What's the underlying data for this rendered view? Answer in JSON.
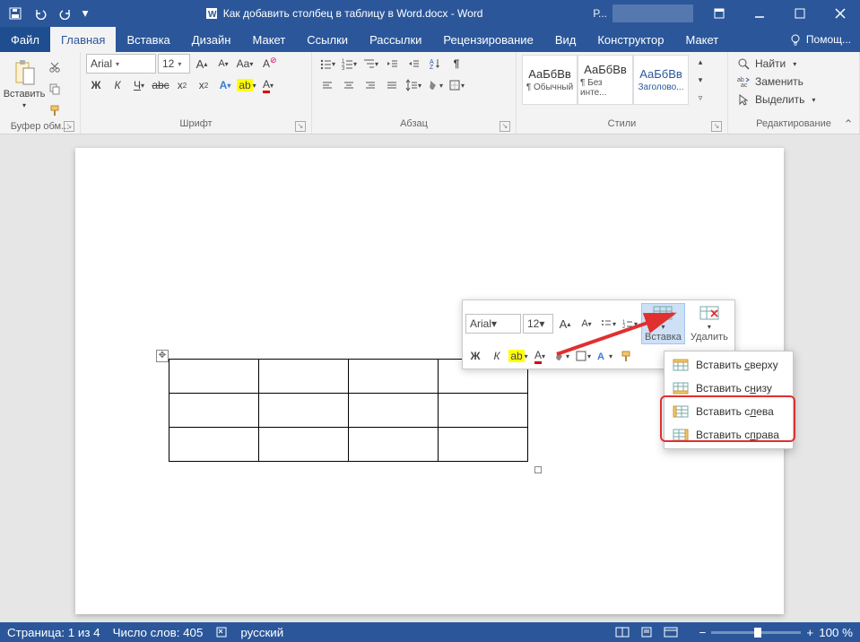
{
  "title": {
    "doc": "Как добавить столбец в таблицу в Word.docx",
    "app": "Word",
    "sep": " - ",
    "account_prefix": "Р..."
  },
  "tabs": {
    "file": "Файл",
    "home": "Главная",
    "insert": "Вставка",
    "design": "Дизайн",
    "layout": "Макет",
    "references": "Ссылки",
    "mailings": "Рассылки",
    "review": "Рецензирование",
    "view": "Вид",
    "tdesign": "Конструктор",
    "tlayout": "Макет",
    "tellme": "Помощ..."
  },
  "ribbon": {
    "clipboard": {
      "label": "Буфер обм...",
      "paste": "Вставить"
    },
    "font": {
      "label": "Шрифт",
      "name": "Arial",
      "size": "12"
    },
    "paragraph": {
      "label": "Абзац"
    },
    "styles": {
      "label": "Стили",
      "preview": "АаБбВв",
      "s1": "¶ Обычный",
      "s2": "¶ Без инте...",
      "s3": "Заголово..."
    },
    "editing": {
      "label": "Редактирование",
      "find": "Найти",
      "replace": "Заменить",
      "select": "Выделить"
    }
  },
  "mini": {
    "font": "Arial",
    "size": "12",
    "insert": "Вставка",
    "delete": "Удалить"
  },
  "menu": {
    "above": {
      "pre": "Вставить ",
      "hot": "с",
      "post": "верху"
    },
    "below": {
      "pre": "Вставить с",
      "hot": "н",
      "post": "изу"
    },
    "left": {
      "pre": "Вставить с",
      "hot": "л",
      "post": "ева"
    },
    "right": {
      "pre": "Вставить с",
      "hot": "п",
      "post": "рава"
    }
  },
  "status": {
    "page": "Страница: 1 из 4",
    "words": "Число слов: 405",
    "lang": "русский",
    "zoom": "100 %"
  }
}
